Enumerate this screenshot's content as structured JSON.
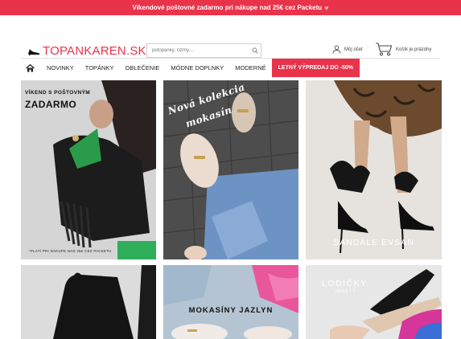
{
  "promo": {
    "text": "Víkendové poštovné zadarmo pri nákupe nad 25€ cez Packetu",
    "heart": "♥"
  },
  "header": {
    "logo_text": "TOPANKAREN.SK",
    "search_placeholder": "potopánky, čižmy,...",
    "account_label": "Môj účet",
    "cart_label": "Košík je prázdny"
  },
  "nav": {
    "items": [
      {
        "label": "NOVINKY"
      },
      {
        "label": "TOPÁNKY"
      },
      {
        "label": "OBLEČENIE"
      },
      {
        "label": "MÓDNE DOPLNKY"
      },
      {
        "label": "MODERNÉ"
      }
    ],
    "sale_label": "LETNÝ VÝPREDAJ DO -50%"
  },
  "banners": {
    "shipping_line1": "VÍKEND S POŠTOVNÝM",
    "shipping_line2": "ZADARMO",
    "shipping_note": "*PLATÍ PRI NÁKUPE NAD 25€ CEZ PACKETU",
    "loafers_line1": "Nová kolekcia",
    "loafers_line2": "mokasín",
    "sandals": "SANDÁLE EVSAN",
    "mocassins": "MOKASÍNY JAZLYN",
    "pumps_line1": "LODIČKY",
    "pumps_line2": "JANETT"
  },
  "colors": {
    "accent": "#e8334a",
    "nav_border": "#e2e2e2"
  }
}
